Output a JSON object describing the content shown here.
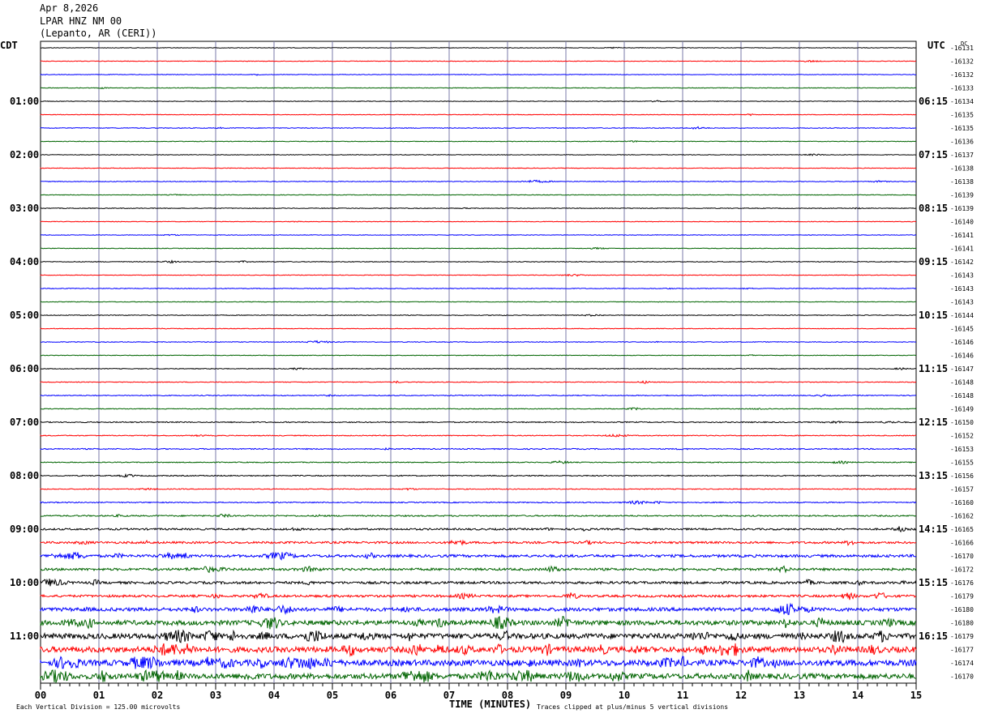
{
  "header": {
    "date": "Apr 8,2026",
    "station": "LPAR HNZ NM 00",
    "location": "(Lepanto, AR (CERI))"
  },
  "chart_data": {
    "type": "line",
    "title": "Apr 8,2026",
    "xlabel": "TIME (MINUTES)",
    "left_tz": "CDT",
    "right_tz": "UTC",
    "dc_label": "DC",
    "x_ticks": [
      "00",
      "01",
      "02",
      "03",
      "04",
      "05",
      "06",
      "07",
      "08",
      "09",
      "10",
      "11",
      "12",
      "13",
      "14",
      "15"
    ],
    "xlim": [
      0,
      15
    ],
    "left_hour_labels": [
      "01:00",
      "02:00",
      "03:00",
      "04:00",
      "05:00",
      "06:00",
      "07:00",
      "08:00",
      "09:00",
      "10:00",
      "11:00"
    ],
    "right_hour_labels": [
      "06:15",
      "07:15",
      "08:15",
      "09:15",
      "10:15",
      "11:15",
      "12:15",
      "13:15",
      "14:15",
      "15:15",
      "16:15"
    ],
    "trace_colors": [
      "#000000",
      "#ff0000",
      "#0000ff",
      "#006400"
    ],
    "dc_offsets": [
      -16131,
      -16132,
      -16132,
      -16133,
      -16134,
      -16135,
      -16135,
      -16136,
      -16137,
      -16138,
      -16138,
      -16139,
      -16139,
      -16140,
      -16141,
      -16141,
      -16142,
      -16143,
      -16143,
      -16143,
      -16144,
      -16145,
      -16146,
      -16146,
      -16147,
      -16148,
      -16148,
      -16149,
      -16150,
      -16152,
      -16153,
      -16155,
      -16156,
      -16157,
      -16160,
      -16162,
      -16165,
      -16166,
      -16170,
      -16172,
      -16176,
      -16179,
      -16180,
      -16180,
      -16179,
      -16177,
      -16174,
      -16170
    ],
    "trace_activity": [
      0.4,
      0.4,
      0.4,
      0.4,
      0.4,
      0.4,
      0.5,
      0.4,
      0.4,
      0.4,
      0.5,
      0.4,
      0.5,
      0.4,
      0.4,
      0.4,
      0.5,
      0.4,
      0.5,
      0.4,
      0.5,
      0.4,
      0.5,
      0.4,
      0.5,
      0.5,
      0.6,
      0.5,
      0.7,
      0.6,
      0.7,
      0.6,
      0.7,
      0.6,
      0.7,
      0.9,
      1.2,
      1.4,
      1.8,
      1.6,
      1.7,
      1.6,
      2.4,
      3.2,
      3.6,
      3.8,
      4.0,
      3.6
    ],
    "footer_left": "Each Vertical Division =  125.00 microvolts",
    "footer_right": "Traces clipped at plus/minus 5 vertical divisions"
  }
}
